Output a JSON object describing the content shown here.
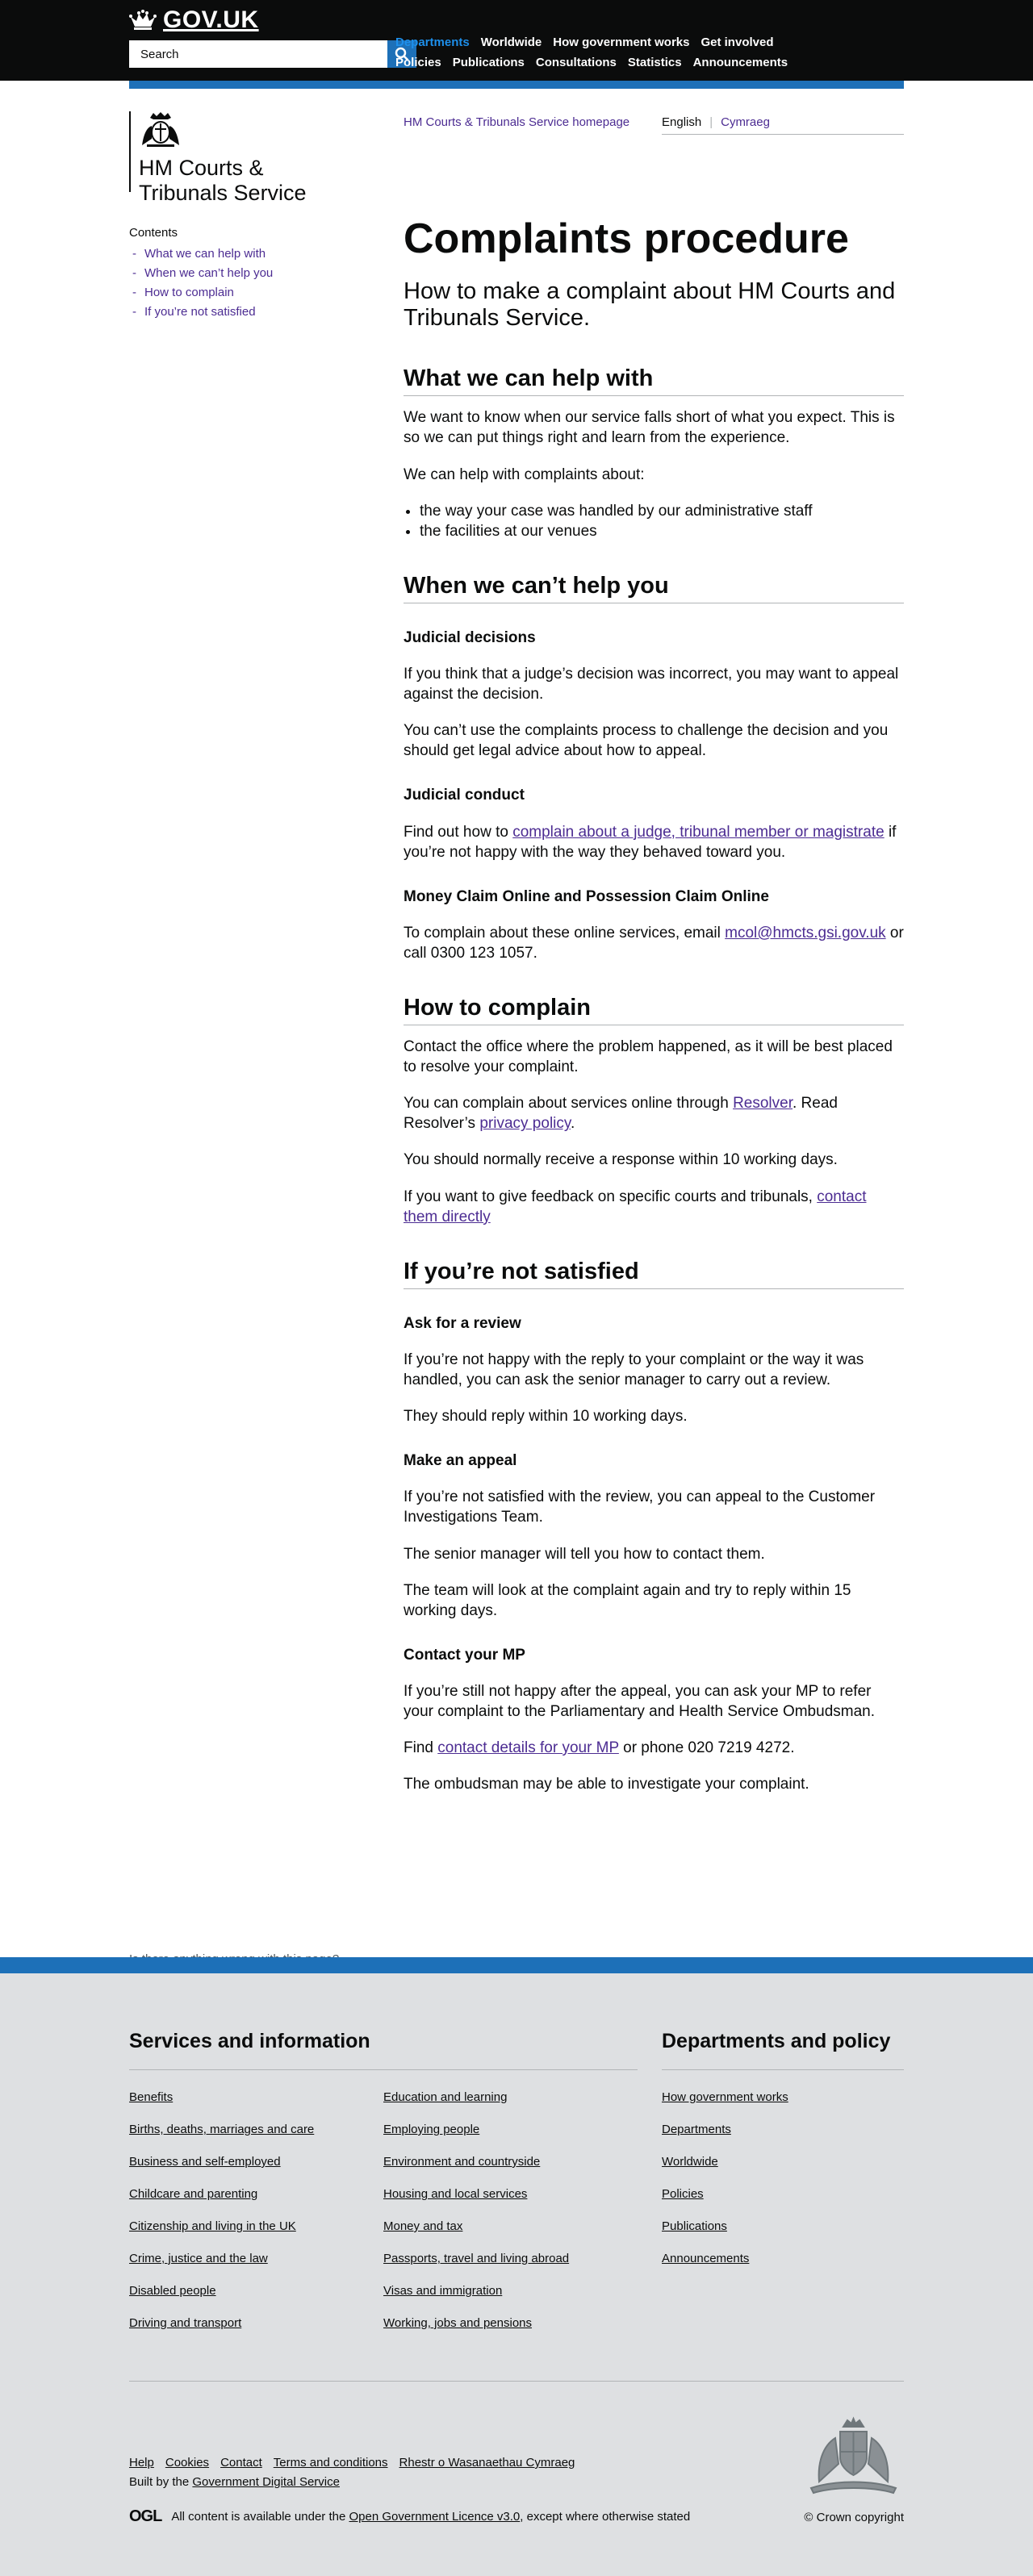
{
  "header": {
    "logo_text": "GOV.UK",
    "search_placeholder": "Search",
    "nav_row1": [
      "Departments",
      "Worldwide",
      "How government works",
      "Get involved"
    ],
    "nav_row2": [
      "Policies",
      "Publications",
      "Consultations",
      "Statistics",
      "Announcements"
    ]
  },
  "org": {
    "name_line1": "HM Courts &",
    "name_line2": "Tribunals Service",
    "homepage_link": "HM Courts & Tribunals Service homepage",
    "lang_english": "English",
    "lang_welsh": "Cymraeg"
  },
  "contents": {
    "title": "Contents",
    "items": [
      "What we can help with",
      "When we can’t help you",
      "How to complain",
      "If you’re not satisfied"
    ]
  },
  "main": {
    "title": "Complaints procedure",
    "lede": "How to make a complaint about HM Courts and Tribunals Service.",
    "s1": {
      "heading": "What we can help with",
      "p1": "We want to know when our service falls short of what you expect. This is so we can put things right and learn from the experience.",
      "p2": "We can help with complaints about:",
      "bullets": [
        "the way your case was handled by our administrative staff",
        "the facilities at our venues"
      ]
    },
    "s2": {
      "heading": "When we can’t help you",
      "h_judicial": "Judicial decisions",
      "p1": "If you think that a judge’s decision was incorrect, you may want to appeal against the decision.",
      "p2": "You can’t use the complaints process to challenge the decision and you should get legal advice about how to appeal.",
      "h_conduct": "Judicial conduct",
      "conduct_pre": "Find out how to ",
      "conduct_link": "complain about a judge, tribunal member or magistrate",
      "conduct_post": " if you’re not happy with the way they behaved toward you.",
      "h_money": "Money Claim Online and Possession Claim Online",
      "money_pre": "To complain about these online services, email ",
      "money_link": "mcol@hmcts.gsi.gov.uk",
      "money_post": " or call 0300 123 1057."
    },
    "s3": {
      "heading": "How to complain",
      "p1": "Contact the office where the problem happened, as it will be best placed to resolve your complaint.",
      "p2_pre": "You can complain about services online through ",
      "p2_link1": "Resolver",
      "p2_mid": ". Read Resolver’s ",
      "p2_link2": "privacy policy",
      "p2_post": ".",
      "p3": "You should normally receive a response within 10 working days.",
      "p4_pre": "If you want to give feedback on specific courts and tribunals, ",
      "p4_link": "contact them directly"
    },
    "s4": {
      "heading": "If you’re not satisfied",
      "h_review": "Ask for a review",
      "review_p1": "If you’re not happy with the reply to your complaint or the way it was handled, you can ask the senior manager to carry out a review.",
      "review_p2": "They should reply within 10 working days.",
      "h_appeal": "Make an appeal",
      "appeal_p1": "If you’re not satisfied with the review, you can appeal to the Customer Investigations Team.",
      "appeal_p2": "The senior manager will tell you how to contact them.",
      "appeal_p3": "The team will look at the complaint again and try to reply within 15 working days.",
      "h_mp": "Contact your MP",
      "mp_p1": "If you’re still not happy after the appeal, you can ask your MP to refer your complaint to the Parliamentary and Health Service Ombudsman.",
      "mp_pre": "Find ",
      "mp_link": "contact details for your MP",
      "mp_post": " or phone 020 7219 4272.",
      "mp_p3": "The ombudsman may be able to investigate your complaint."
    }
  },
  "report_link": "Is there anything wrong with this page?",
  "footer": {
    "services_title": "Services and information",
    "services_col1": [
      "Benefits",
      "Births, deaths, marriages and care",
      "Business and self-employed",
      "Childcare and parenting",
      "Citizenship and living in the UK",
      "Crime, justice and the law",
      "Disabled people",
      "Driving and transport"
    ],
    "services_col2": [
      "Education and learning",
      "Employing people",
      "Environment and countryside",
      "Housing and local services",
      "Money and tax",
      "Passports, travel and living abroad",
      "Visas and immigration",
      "Working, jobs and pensions"
    ],
    "depts_title": "Departments and policy",
    "depts_items": [
      "How government works",
      "Departments",
      "Worldwide",
      "Policies",
      "Publications",
      "Announcements"
    ],
    "meta_links": [
      "Help",
      "Cookies",
      "Contact",
      "Terms and conditions",
      "Rhestr o Wasanaethau Cymraeg"
    ],
    "built_pre": "Built by the ",
    "built_link": "Government Digital Service",
    "ogl": "OGL",
    "licence_pre": "All content is available under the ",
    "licence_link": "Open Government Licence v3.0",
    "licence_post": ", except where otherwise stated",
    "copyright": "© Crown copyright"
  },
  "colors": {
    "header_bg": "#0b0c0c",
    "brand_blue": "#1d70b8",
    "link": "#4c2c92",
    "footer_bg": "#dee0e2"
  }
}
